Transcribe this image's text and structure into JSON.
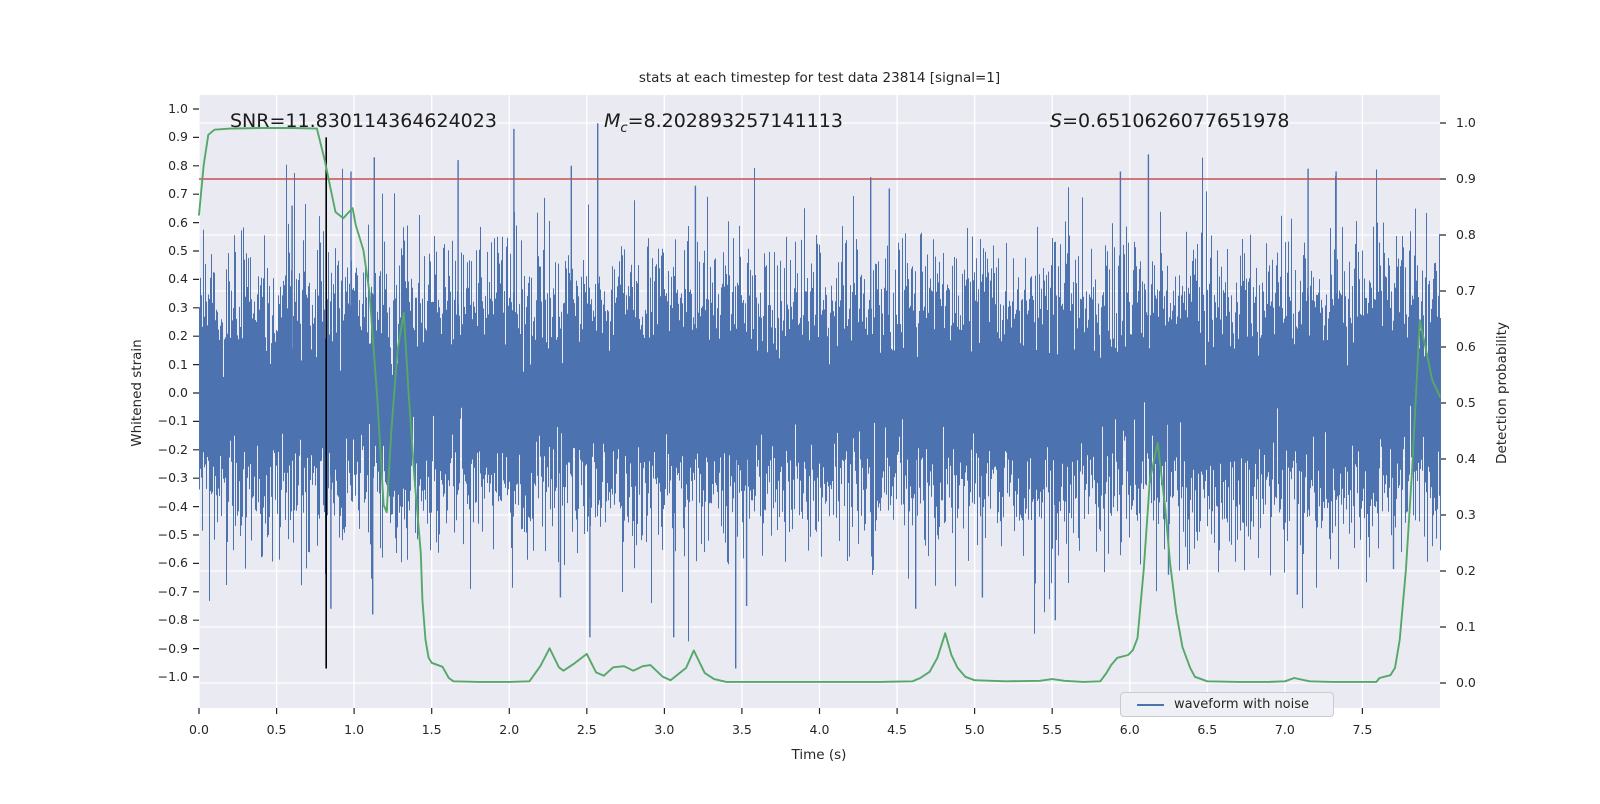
{
  "title": "stats at each timestep for test data 23814 [signal=1]",
  "annotations": {
    "snr": "SNR=11.830114364624023",
    "mc_var": "M",
    "mc_sub": "c",
    "mc_rest": "=8.202893257141113",
    "s_var": "S",
    "s_rest": "=0.6510626077651978"
  },
  "axes": {
    "x": {
      "label": "Time (s)",
      "ticks": [
        "0.0",
        "0.5",
        "1.0",
        "1.5",
        "2.0",
        "2.5",
        "3.0",
        "3.5",
        "4.0",
        "4.5",
        "5.0",
        "5.5",
        "6.0",
        "6.5",
        "7.0",
        "7.5"
      ]
    },
    "left": {
      "label": "Whitened strain",
      "ticks": [
        "1.0",
        "0.9",
        "0.8",
        "0.7",
        "0.6",
        "0.5",
        "0.4",
        "0.3",
        "0.2",
        "0.1",
        "0.0",
        "−0.1",
        "−0.2",
        "−0.3",
        "−0.4",
        "−0.5",
        "−0.6",
        "−0.7",
        "−0.8",
        "−0.9",
        "−1.0"
      ]
    },
    "right": {
      "label": "Detection probability",
      "ticks": [
        "1.0",
        "0.9",
        "0.8",
        "0.7",
        "0.6",
        "0.5",
        "0.4",
        "0.3",
        "0.2",
        "0.1",
        "0.0"
      ]
    }
  },
  "legend": {
    "items": [
      {
        "label": "waveform with noise",
        "color": "#4c72b0"
      }
    ]
  },
  "colors": {
    "noise": "#4c72b0",
    "probability": "#55a868",
    "threshold": "#c44e52",
    "event_line": "#000000",
    "plot_bg": "#eaeaf2",
    "grid": "#ffffff",
    "text": "#262626"
  },
  "chart_data": {
    "type": "line",
    "title": "stats at each timestep for test data 23814 [signal=1]",
    "xlabel": "Time (s)",
    "xlim": [
      0,
      8
    ],
    "left_axis": {
      "label": "Whitened strain",
      "lim": [
        -1.08,
        1.05
      ],
      "tick_step": 0.1
    },
    "right_axis": {
      "label": "Detection probability",
      "lim": [
        -0.045,
        1.055
      ],
      "tick_step": 0.1
    },
    "grid": true,
    "legend_position": "lower right",
    "threshold": {
      "axis": "right",
      "value": 0.9,
      "color": "#c44e52"
    },
    "event_vline": {
      "t": 0.82,
      "y_from": 0.9,
      "y_to": -0.97,
      "color": "#000000"
    },
    "series": [
      {
        "name": "waveform with noise",
        "axis": "left",
        "type": "noise",
        "color": "#4c72b0",
        "sigma": 0.215,
        "samples_per_pixel": 13,
        "seed": 23814,
        "spikes": [
          [
            0.6,
            0.66
          ],
          [
            0.85,
            -0.76
          ],
          [
            0.98,
            0.78
          ],
          [
            1.12,
            -0.78
          ],
          [
            1.13,
            0.83
          ],
          [
            1.67,
            0.82
          ],
          [
            2.03,
            0.93
          ],
          [
            2.33,
            -0.72
          ],
          [
            2.4,
            0.8
          ],
          [
            2.52,
            -0.86
          ],
          [
            2.57,
            0.95
          ],
          [
            3.06,
            -0.86
          ],
          [
            3.2,
            0.73
          ],
          [
            3.46,
            -0.97
          ],
          [
            3.53,
            -0.75
          ],
          [
            4.33,
            0.76
          ],
          [
            4.45,
            0.72
          ],
          [
            4.62,
            -0.76
          ],
          [
            5.05,
            -0.72
          ],
          [
            5.52,
            -0.8
          ],
          [
            5.94,
            0.78
          ],
          [
            6.12,
            0.84
          ],
          [
            6.25,
            -0.64
          ],
          [
            7.08,
            -0.71
          ],
          [
            7.15,
            0.79
          ],
          [
            7.33,
            0.78
          ],
          [
            7.7,
            -0.62
          ]
        ]
      },
      {
        "name": "detection probability",
        "axis": "right",
        "type": "line",
        "color": "#55a868",
        "points": [
          [
            0.0,
            0.836
          ],
          [
            0.03,
            0.925
          ],
          [
            0.06,
            0.979
          ],
          [
            0.1,
            0.988
          ],
          [
            0.2,
            0.99
          ],
          [
            0.4,
            0.991
          ],
          [
            0.6,
            0.991
          ],
          [
            0.76,
            0.99
          ],
          [
            0.81,
            0.934
          ],
          [
            0.85,
            0.88
          ],
          [
            0.88,
            0.841
          ],
          [
            0.93,
            0.83
          ],
          [
            0.99,
            0.848
          ],
          [
            1.01,
            0.818
          ],
          [
            1.06,
            0.773
          ],
          [
            1.1,
            0.696
          ],
          [
            1.15,
            0.505
          ],
          [
            1.19,
            0.318
          ],
          [
            1.21,
            0.305
          ],
          [
            1.24,
            0.452
          ],
          [
            1.28,
            0.595
          ],
          [
            1.32,
            0.661
          ],
          [
            1.35,
            0.523
          ],
          [
            1.39,
            0.363
          ],
          [
            1.43,
            0.232
          ],
          [
            1.44,
            0.148
          ],
          [
            1.46,
            0.077
          ],
          [
            1.48,
            0.045
          ],
          [
            1.5,
            0.036
          ],
          [
            1.57,
            0.029
          ],
          [
            1.61,
            0.009
          ],
          [
            1.64,
            0.003
          ],
          [
            1.8,
            0.002
          ],
          [
            2.0,
            0.002
          ],
          [
            2.13,
            0.003
          ],
          [
            2.2,
            0.03
          ],
          [
            2.26,
            0.062
          ],
          [
            2.32,
            0.028
          ],
          [
            2.35,
            0.022
          ],
          [
            2.42,
            0.035
          ],
          [
            2.5,
            0.052
          ],
          [
            2.56,
            0.019
          ],
          [
            2.61,
            0.013
          ],
          [
            2.67,
            0.028
          ],
          [
            2.74,
            0.03
          ],
          [
            2.8,
            0.022
          ],
          [
            2.86,
            0.03
          ],
          [
            2.91,
            0.032
          ],
          [
            2.99,
            0.011
          ],
          [
            3.04,
            0.005
          ],
          [
            3.14,
            0.027
          ],
          [
            3.19,
            0.058
          ],
          [
            3.26,
            0.018
          ],
          [
            3.32,
            0.007
          ],
          [
            3.4,
            0.002
          ],
          [
            3.6,
            0.002
          ],
          [
            3.8,
            0.002
          ],
          [
            4.0,
            0.002
          ],
          [
            4.2,
            0.002
          ],
          [
            4.4,
            0.002
          ],
          [
            4.6,
            0.003
          ],
          [
            4.65,
            0.009
          ],
          [
            4.71,
            0.02
          ],
          [
            4.76,
            0.045
          ],
          [
            4.81,
            0.089
          ],
          [
            4.85,
            0.05
          ],
          [
            4.89,
            0.027
          ],
          [
            4.94,
            0.011
          ],
          [
            5.0,
            0.005
          ],
          [
            5.2,
            0.003
          ],
          [
            5.42,
            0.004
          ],
          [
            5.5,
            0.007
          ],
          [
            5.58,
            0.004
          ],
          [
            5.7,
            0.002
          ],
          [
            5.81,
            0.003
          ],
          [
            5.85,
            0.018
          ],
          [
            5.88,
            0.032
          ],
          [
            5.92,
            0.045
          ],
          [
            5.99,
            0.05
          ],
          [
            6.02,
            0.059
          ],
          [
            6.05,
            0.08
          ],
          [
            6.09,
            0.202
          ],
          [
            6.13,
            0.363
          ],
          [
            6.18,
            0.429
          ],
          [
            6.23,
            0.309
          ],
          [
            6.26,
            0.214
          ],
          [
            6.3,
            0.125
          ],
          [
            6.34,
            0.064
          ],
          [
            6.39,
            0.027
          ],
          [
            6.42,
            0.011
          ],
          [
            6.5,
            0.003
          ],
          [
            6.7,
            0.002
          ],
          [
            6.9,
            0.002
          ],
          [
            7.0,
            0.003
          ],
          [
            7.06,
            0.009
          ],
          [
            7.16,
            0.003
          ],
          [
            7.3,
            0.002
          ],
          [
            7.45,
            0.002
          ],
          [
            7.59,
            0.002
          ],
          [
            7.61,
            0.009
          ],
          [
            7.68,
            0.014
          ],
          [
            7.71,
            0.027
          ],
          [
            7.74,
            0.077
          ],
          [
            7.78,
            0.202
          ],
          [
            7.82,
            0.38
          ],
          [
            7.87,
            0.648
          ],
          [
            7.91,
            0.595
          ],
          [
            7.95,
            0.541
          ],
          [
            8.0,
            0.511
          ]
        ]
      }
    ]
  }
}
